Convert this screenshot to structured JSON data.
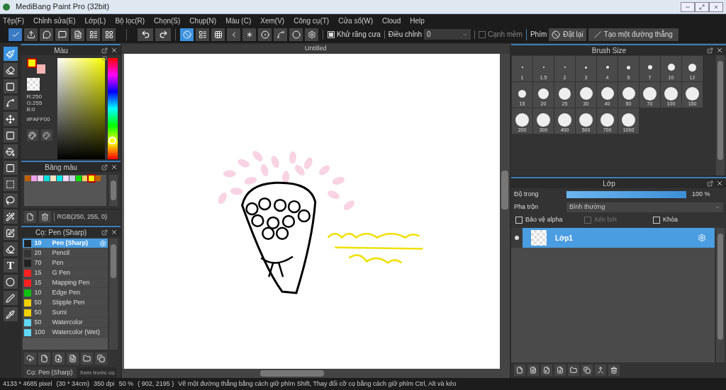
{
  "window": {
    "title": "MediBang Paint Pro (32bit)"
  },
  "menu": [
    "Tệp(F)",
    "Chỉnh sửa(E)",
    "Lớp(L)",
    "Bộ lọc(R)",
    "Chọn(S)",
    "Chụp(N)",
    "Màu (C)",
    "Xem(V)",
    "Công cụ(T)",
    "Cửa sổ(W)",
    "Cloud",
    "Help"
  ],
  "toolbar": {
    "snap_tools": [
      {
        "selected": true
      },
      {
        "selected": false
      },
      {
        "selected": false
      },
      {
        "selected": false
      },
      {
        "selected": false
      },
      {
        "selected": false
      },
      {
        "selected": false
      },
      {
        "selected": false
      },
      {
        "selected": false
      }
    ],
    "antialias": {
      "label": "Khử răng cưa",
      "checked": true
    },
    "adjust": {
      "label": "Điều chỉnh",
      "value": "0"
    },
    "soft_edge": {
      "label": "Cạnh mềm",
      "checked": false
    },
    "keys_label": "Phím",
    "reset_button": "Đặt lại",
    "line_button": "Tạo một đường thẳng"
  },
  "tools": [
    {
      "selected": true
    },
    {
      "selected": false
    },
    {
      "selected": false
    },
    {
      "selected": false
    },
    {
      "selected": false
    },
    {
      "selected": false
    },
    {
      "selected": false
    },
    {
      "selected": false
    },
    {
      "selected": false
    },
    {
      "selected": false
    },
    {
      "selected": false
    },
    {
      "selected": false
    },
    {
      "selected": false
    },
    {
      "selected": false
    },
    {
      "selected": false
    },
    {
      "selected": false
    },
    {
      "selected": false
    }
  ],
  "text_tool_glyph": "T",
  "color_panel": {
    "title": "Màu",
    "r": "R:250",
    "g": "G:255",
    "b": "B:0",
    "hex": "#FAFF00"
  },
  "palette_panel": {
    "title": "Bảng màu",
    "swatches": [
      {
        "color": "#c06000",
        "selected": false
      },
      {
        "color": "#f0a0f0",
        "selected": false
      },
      {
        "color": "#f8d0f0",
        "selected": false
      },
      {
        "color": "#00e0e0",
        "selected": false
      },
      {
        "color": "#fce4c0",
        "selected": false
      },
      {
        "color": "#00e8e8",
        "selected": false
      },
      {
        "color": "#f4d8f4",
        "selected": false
      },
      {
        "color": "#c8c8e8",
        "selected": false
      },
      {
        "color": "#00e000",
        "selected": false
      },
      {
        "color": "#fcd060",
        "selected": false
      },
      {
        "color": "#faff00",
        "selected": true
      },
      {
        "color": "#c06000",
        "selected": false
      }
    ],
    "readout": "RGB(250, 255, 0)"
  },
  "brush_panel": {
    "title": "Cọ: Pen (Sharp)",
    "items": [
      {
        "size": "10",
        "name": "Pen (Sharp)",
        "color": "#222222",
        "selected": true
      },
      {
        "size": "20",
        "name": "Pencil",
        "color": "#333333",
        "selected": false
      },
      {
        "size": "70",
        "name": "Pen",
        "color": "#222222",
        "selected": false
      },
      {
        "size": "15",
        "name": "G Pen",
        "color": "#ff2020",
        "selected": false
      },
      {
        "size": "15",
        "name": "Mapping Pen",
        "color": "#ff2020",
        "selected": false
      },
      {
        "size": "10",
        "name": "Edge Pen",
        "color": "#10c010",
        "selected": false
      },
      {
        "size": "50",
        "name": "Stipple Pen",
        "color": "#f0d000",
        "selected": false
      },
      {
        "size": "50",
        "name": "Sumi",
        "color": "#f0d000",
        "selected": false
      },
      {
        "size": "50",
        "name": "Watercolor",
        "color": "#60d8f8",
        "selected": false
      },
      {
        "size": "100",
        "name": "Watercolor (Wet)",
        "color": "#60d8f8",
        "selected": false
      }
    ],
    "tabs": [
      {
        "label": "Cọ: Pen (Sharp)",
        "selected": true
      },
      {
        "label": "Xem trước cọ",
        "selected": false
      }
    ]
  },
  "canvas": {
    "tab": "Untitled"
  },
  "brush_size_panel": {
    "title": "Brush Size",
    "sizes": [
      "1",
      "1.5",
      "2",
      "3",
      "4",
      "5",
      "7",
      "10",
      "12",
      "15",
      "20",
      "25",
      "30",
      "40",
      "50",
      "70",
      "100",
      "150",
      "200",
      "300",
      "400",
      "500",
      "700",
      "1000"
    ]
  },
  "layer_panel": {
    "title": "Lớp",
    "opacity_label": "Độ trong",
    "opacity": {
      "level": 1.0
    },
    "opacity_text": "100 %",
    "blend_label": "Pha trộn",
    "blend_value": "Bình thường",
    "options": [
      {
        "label": "Bảo vệ alpha",
        "checked": false,
        "disabled": false
      },
      {
        "label": "Xén bớt",
        "checked": false,
        "disabled": true
      },
      {
        "label": "Khóa",
        "checked": false,
        "disabled": false
      }
    ],
    "layers": [
      {
        "name": "Lớp1",
        "visible": true,
        "selected": true
      }
    ]
  },
  "status_bar": [
    "4133 * 4685 pixel",
    "(30 * 34cm)",
    "350 dpi",
    "50 %",
    "( 902, 2195 )",
    "Vẽ một đường thẳng bằng cách giữ phím Shift, Thay đổi cỡ cọ bằng cách giữ phím Ctrl, Alt và kéo"
  ]
}
